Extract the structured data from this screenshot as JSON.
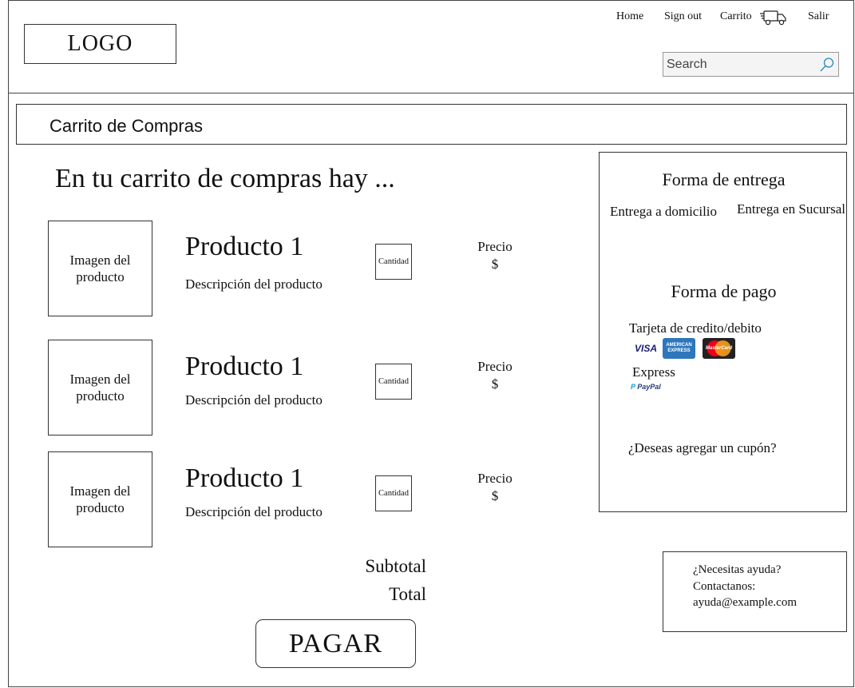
{
  "header": {
    "logo": "LOGO",
    "nav": {
      "home": "Home",
      "sign_out": "Sign out",
      "cart": "Carrito",
      "exit": "Salir"
    },
    "search": {
      "placeholder": "Search",
      "value": ""
    }
  },
  "breadcrumb": "Carrito de Compras",
  "main": {
    "title": "En tu carrito de compras hay ...",
    "products": [
      {
        "image_label": "Imagen del producto",
        "name": "Producto 1",
        "description": "Descripción del producto",
        "quantity_label": "Cantidad",
        "price_label": "Precio",
        "price_value": "$"
      },
      {
        "image_label": "Imagen del producto",
        "name": "Producto 1",
        "description": "Descripción del producto",
        "quantity_label": "Cantidad",
        "price_label": "Precio",
        "price_value": "$"
      },
      {
        "image_label": "Imagen del producto",
        "name": "Producto 1",
        "description": "Descripción del producto",
        "quantity_label": "Cantidad",
        "price_label": "Precio",
        "price_value": "$"
      }
    ],
    "subtotal_label": "Subtotal",
    "total_label": "Total",
    "pay_button": "PAGAR"
  },
  "sidebar": {
    "delivery_title": "Forma de entrega",
    "delivery_options": [
      "Entrega a domicilio",
      "Entrega en Sucursal"
    ],
    "payment_title": "Forma de pago",
    "card_option": "Tarjeta de credito/debito",
    "cards": [
      "VISA",
      "AMERICAN EXPRESS",
      "MasterCard"
    ],
    "express_option": "Express",
    "paypal": "PayPal",
    "coupon": "¿Deseas agregar un cupón?"
  },
  "help": {
    "line1": "¿Necesitas ayuda?",
    "line2": "Contactanos:",
    "email": "ayuda@example.com"
  },
  "icons": [
    "truck-icon",
    "search-icon"
  ]
}
